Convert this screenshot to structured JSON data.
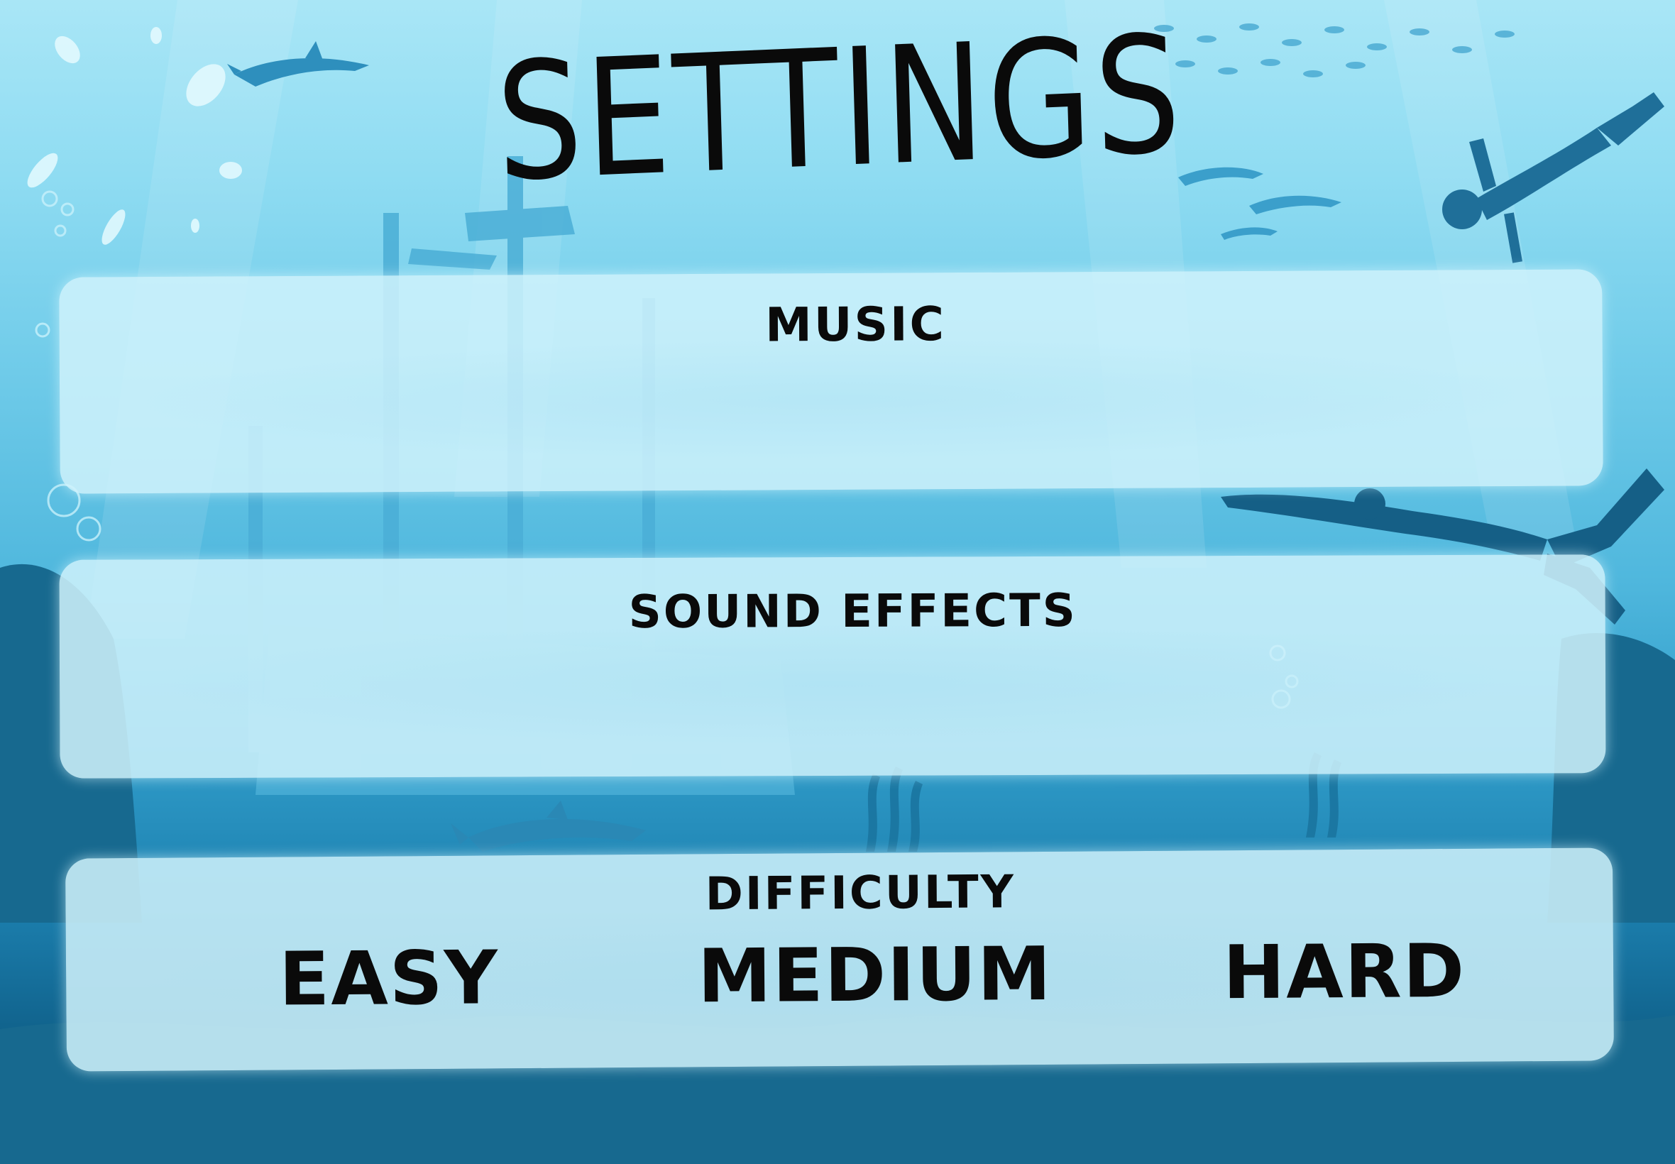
{
  "title": "SETTINGS",
  "music": {
    "label": "MUSIC"
  },
  "sound_effects": {
    "label": "SOUND EFFECTS"
  },
  "difficulty": {
    "label": "DIFFICULTY",
    "options": [
      "EASY",
      "MEDIUM",
      "HARD"
    ]
  },
  "colors": {
    "water_top": "#a9e6f6",
    "water_bottom": "#0b4d71",
    "panel": "#cff2fc",
    "text": "#0a0a0a",
    "silhouette": "#1d7fab"
  }
}
